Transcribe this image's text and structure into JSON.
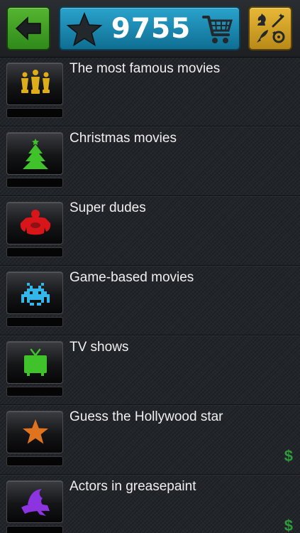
{
  "header": {
    "back_icon": "arrow-left-icon",
    "score": "9755",
    "star_icon": "star-icon",
    "cart_icon": "shopping-cart-icon",
    "tools_icons": [
      "chess-knight-icon",
      "magic-wand-icon",
      "rocket-icon",
      "refresh-icon"
    ],
    "colors": {
      "back": "#3d9e25",
      "score": "#1a86b0",
      "tools": "#d7a627"
    }
  },
  "categories": [
    {
      "title": "The most famous movies",
      "icon": "oscar-statues-icon",
      "icon_color": "#e0ad1a",
      "progress": 0,
      "price": ""
    },
    {
      "title": "Christmas movies",
      "icon": "christmas-tree-icon",
      "icon_color": "#3fc22a",
      "progress": 0,
      "price": ""
    },
    {
      "title": "Super dudes",
      "icon": "superhero-icon",
      "icon_color": "#d8161a",
      "progress": 0,
      "price": ""
    },
    {
      "title": "Game-based movies",
      "icon": "space-invader-icon",
      "icon_color": "#33b7ea",
      "progress": 0,
      "price": ""
    },
    {
      "title": "TV shows",
      "icon": "tv-icon",
      "icon_color": "#3fc22a",
      "progress": 0,
      "price": ""
    },
    {
      "title": "Guess the Hollywood star",
      "icon": "star-icon",
      "icon_color": "#e0731d",
      "progress": 0,
      "price": "$"
    },
    {
      "title": "Actors in greasepaint",
      "icon": "witch-hat-icon",
      "icon_color": "#8b34e0",
      "progress": 0,
      "price": "$"
    }
  ]
}
